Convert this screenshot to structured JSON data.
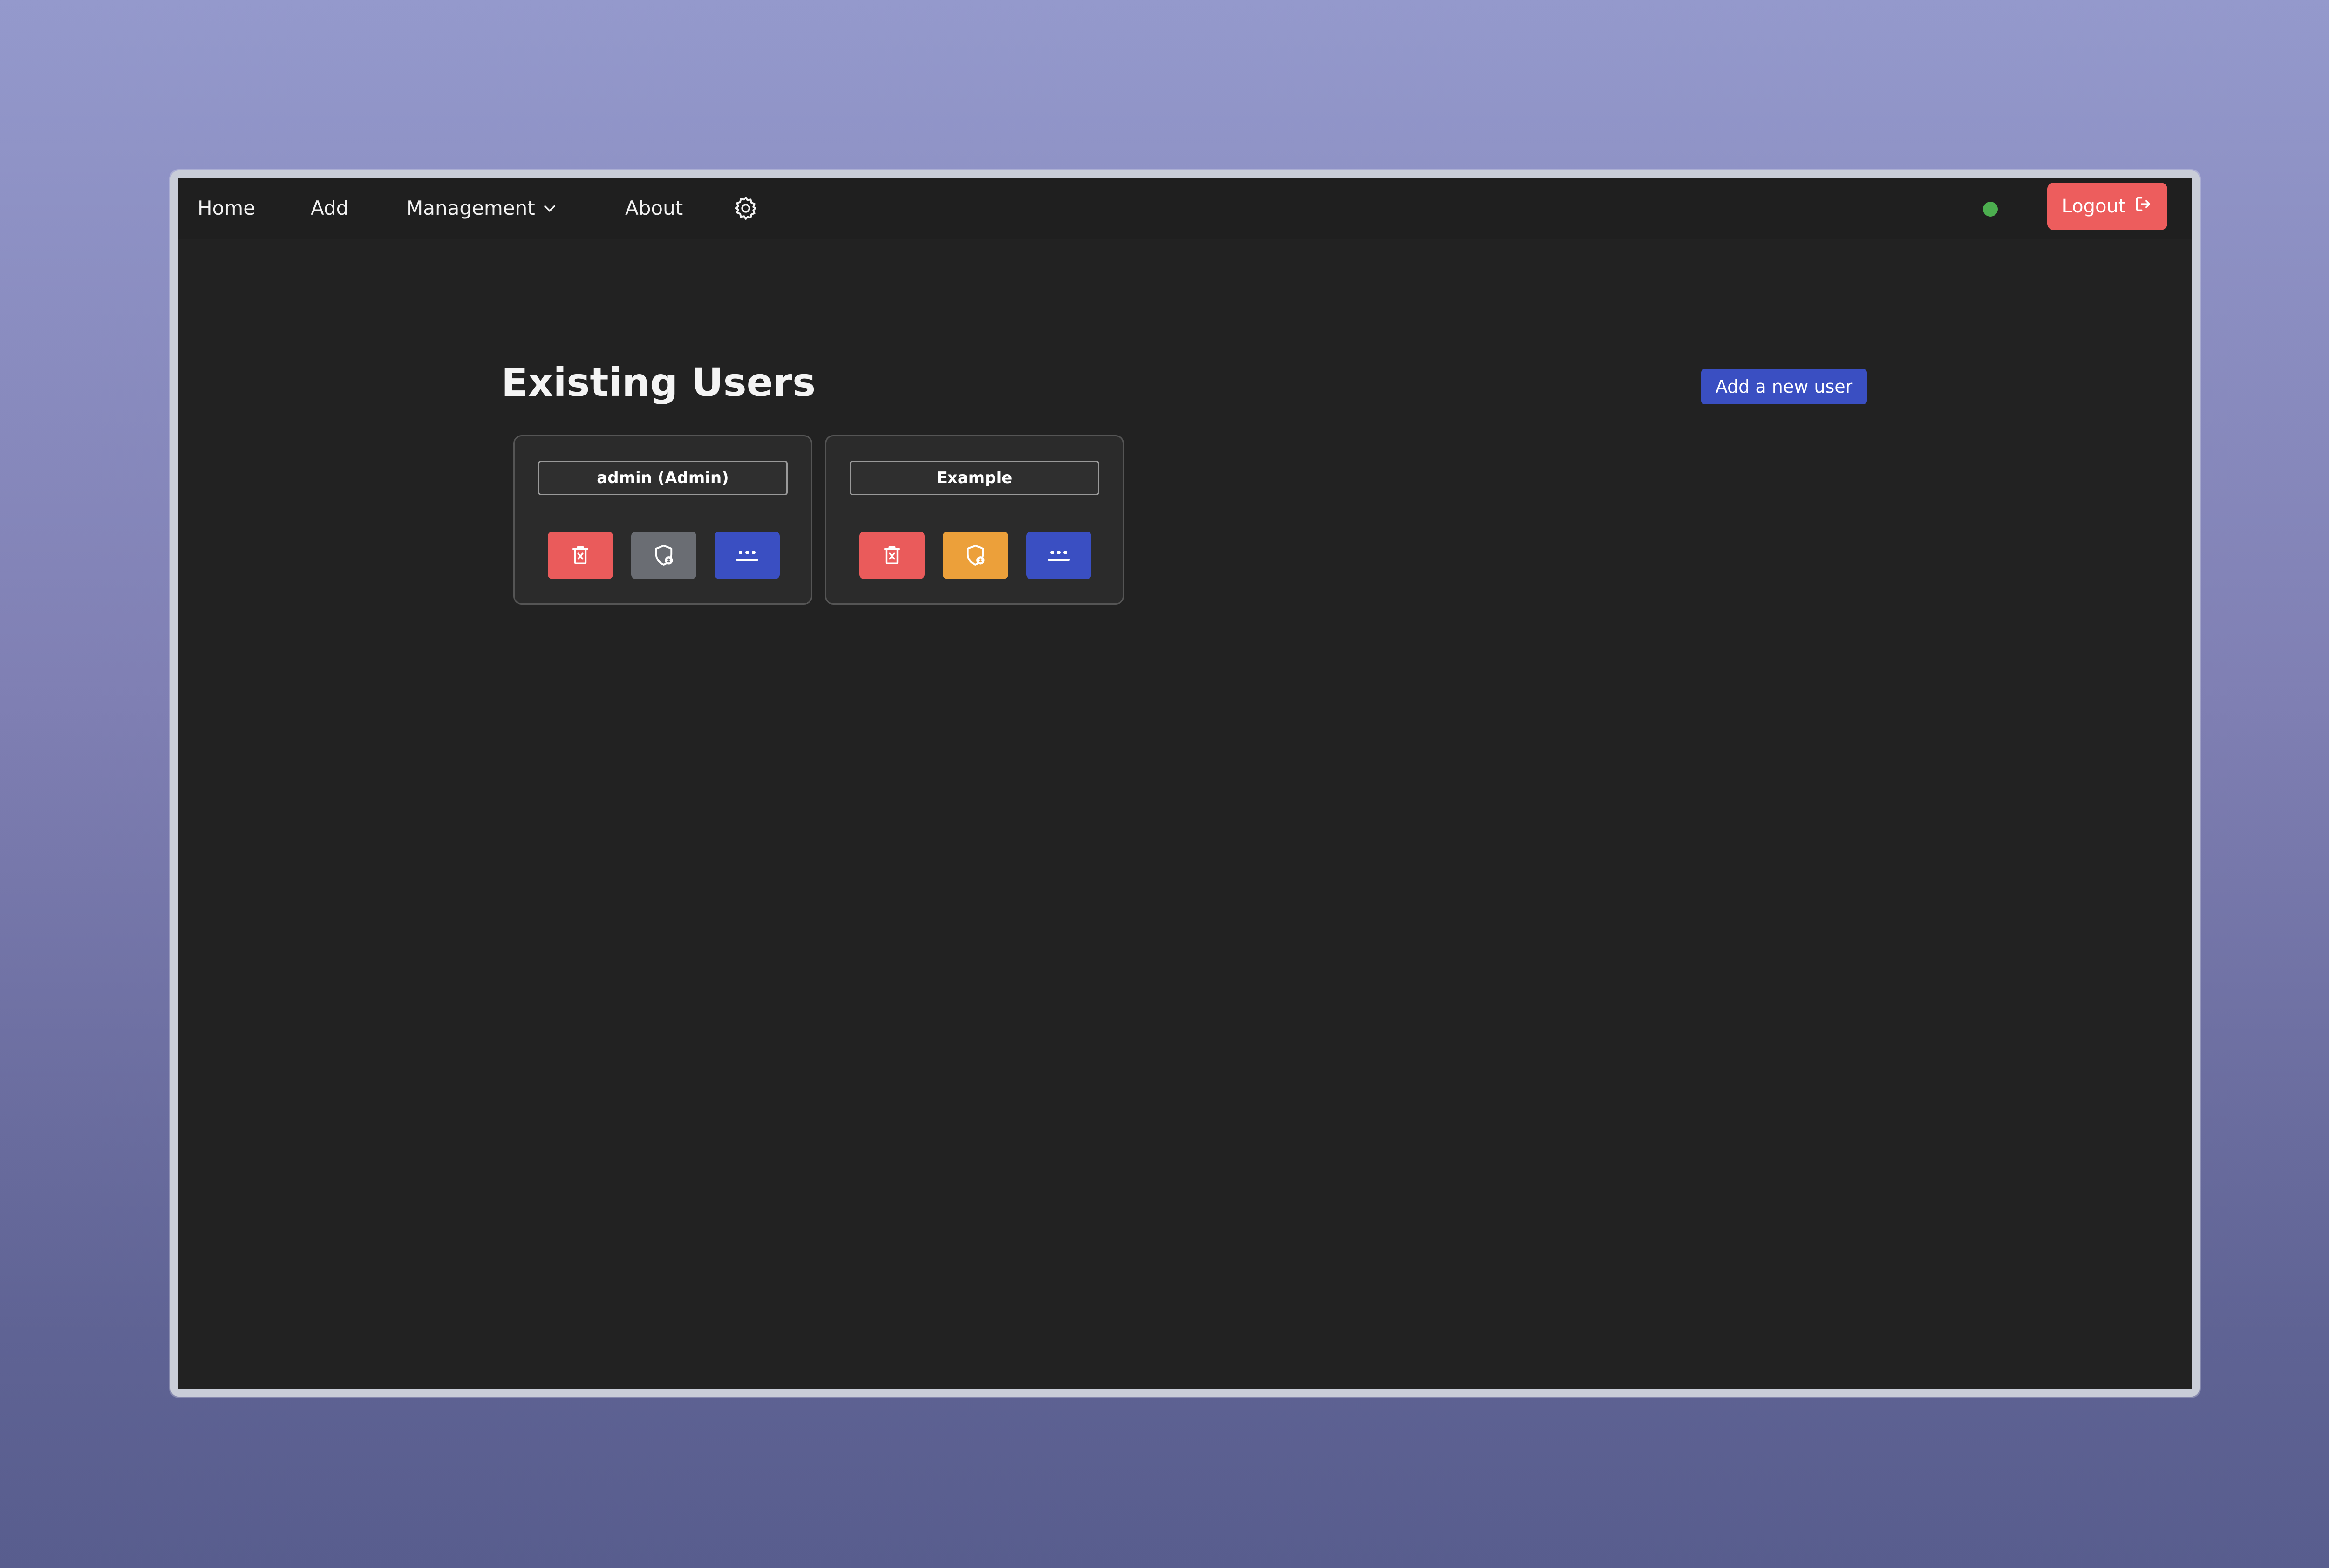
{
  "nav": {
    "items": [
      {
        "label": "Home"
      },
      {
        "label": "Add"
      },
      {
        "label": "Management",
        "icon": "chevron-down-icon"
      },
      {
        "label": "About"
      }
    ],
    "settings_icon": "gear-icon",
    "status_color": "#4cae4f",
    "logout_label": "Logout",
    "logout_icon": "logout-icon"
  },
  "main": {
    "title": "Existing Users",
    "add_user_label": "Add a new user"
  },
  "users": [
    {
      "name": "admin (Admin)",
      "actions": [
        {
          "icon": "trash-icon",
          "color": "#ea5b5b"
        },
        {
          "icon": "shield-icon",
          "color": "#6a6d73"
        },
        {
          "icon": "password-icon",
          "color": "#3a4fc2"
        }
      ]
    },
    {
      "name": "Example",
      "actions": [
        {
          "icon": "trash-icon",
          "color": "#ea5b5b"
        },
        {
          "icon": "shield-icon",
          "color": "#eca03a"
        },
        {
          "icon": "password-icon",
          "color": "#3a4fc2"
        }
      ]
    }
  ],
  "colors": {
    "background": "#222222",
    "navbar": "#1f1f1f",
    "danger": "#ed5d5d",
    "primary": "#3a4fc2"
  }
}
